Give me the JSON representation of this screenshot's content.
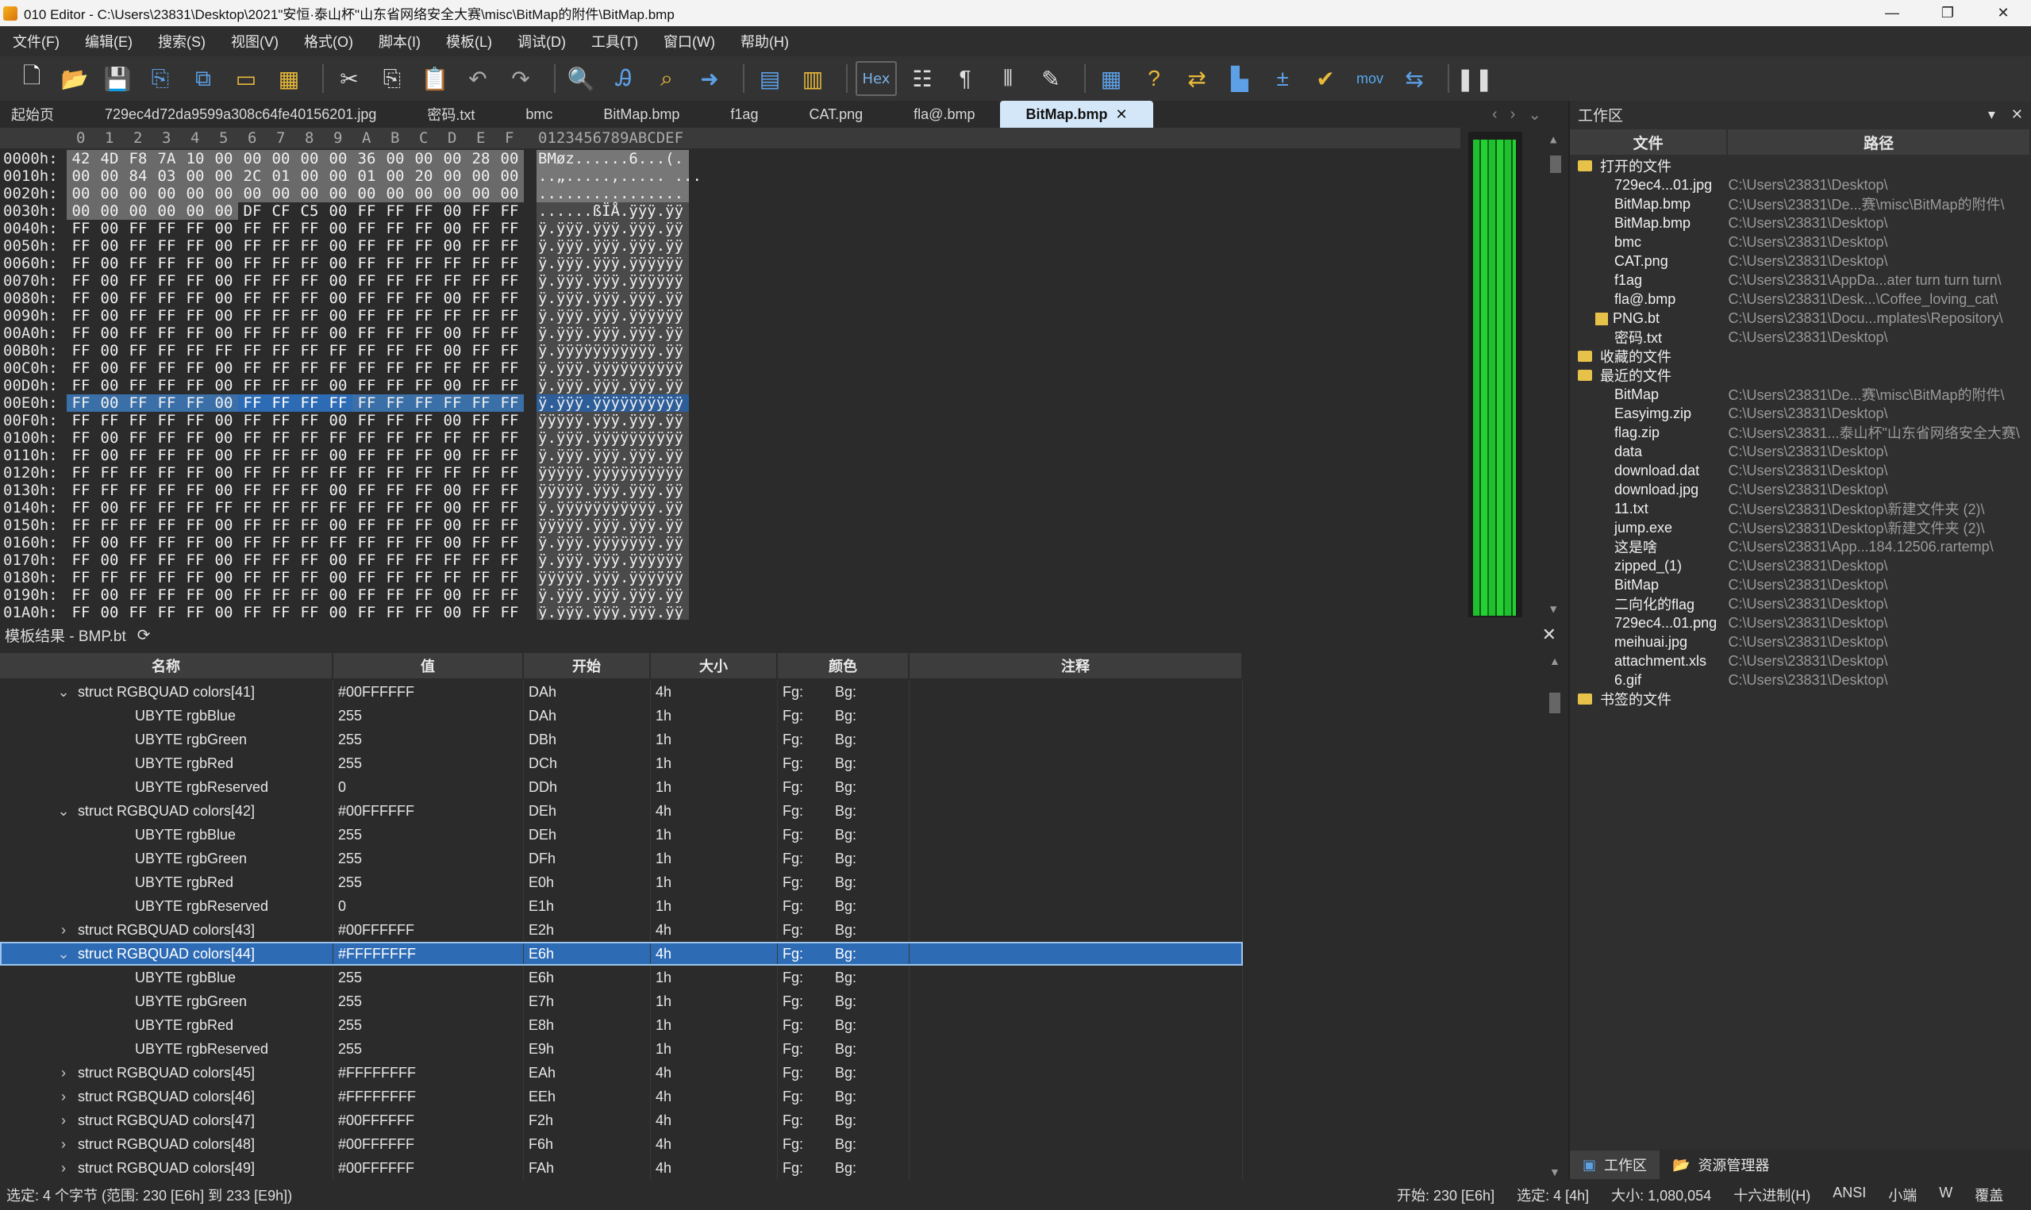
{
  "window": {
    "title": "010 Editor - C:\\Users\\23831\\Desktop\\2021\"安恒·泰山杯\"山东省网络安全大赛\\misc\\BitMap的附件\\BitMap.bmp",
    "minimize": "—",
    "maximize": "❐",
    "close": "✕"
  },
  "menu": [
    "文件(F)",
    "编辑(E)",
    "搜索(S)",
    "视图(V)",
    "格式(O)",
    "脚本(I)",
    "模板(L)",
    "调试(D)",
    "工具(T)",
    "窗口(W)",
    "帮助(H)"
  ],
  "toolbar": {
    "hex_label": "Hex",
    "mov_label": "mov"
  },
  "tabs": [
    {
      "label": "起始页"
    },
    {
      "label": "729ec4d72da9599a308c64fe40156201.jpg"
    },
    {
      "label": "密码.txt"
    },
    {
      "label": "bmc"
    },
    {
      "label": "BitMap.bmp"
    },
    {
      "label": "f1ag"
    },
    {
      "label": "CAT.png"
    },
    {
      "label": "fla@.bmp"
    },
    {
      "label": "BitMap.bmp",
      "active": true
    }
  ],
  "hex": {
    "header_cols": [
      "0",
      "1",
      "2",
      "3",
      "4",
      "5",
      "6",
      "7",
      "8",
      "9",
      "A",
      "B",
      "C",
      "D",
      "E",
      "F"
    ],
    "header_ascii": "0123456789ABCDEF",
    "rows": [
      {
        "addr": "0000h:",
        "bytes": [
          "42",
          "4D",
          "F8",
          "7A",
          "10",
          "00",
          "00",
          "00",
          "00",
          "00",
          "36",
          "00",
          "00",
          "00",
          "28",
          "00"
        ],
        "ascii": "BMøz......6...(.",
        "gray": true
      },
      {
        "addr": "0010h:",
        "bytes": [
          "00",
          "00",
          "84",
          "03",
          "00",
          "00",
          "2C",
          "01",
          "00",
          "00",
          "01",
          "00",
          "20",
          "00",
          "00",
          "00"
        ],
        "ascii": "..„.....,..... ...",
        "gray": true
      },
      {
        "addr": "0020h:",
        "bytes": [
          "00",
          "00",
          "00",
          "00",
          "00",
          "00",
          "00",
          "00",
          "00",
          "00",
          "00",
          "00",
          "00",
          "00",
          "00",
          "00"
        ],
        "ascii": "................",
        "gray": true
      },
      {
        "addr": "0030h:",
        "bytes": [
          "00",
          "00",
          "00",
          "00",
          "00",
          "00",
          "DF",
          "CF",
          "C5",
          "00",
          "FF",
          "FF",
          "FF",
          "00",
          "FF",
          "FF"
        ],
        "ascii": "......ßÏÅ.ÿÿÿ.ÿÿ",
        "gray6": true
      },
      {
        "addr": "0040h:",
        "bytes": [
          "FF",
          "00",
          "FF",
          "FF",
          "FF",
          "00",
          "FF",
          "FF",
          "FF",
          "00",
          "FF",
          "FF",
          "FF",
          "00",
          "FF",
          "FF"
        ],
        "ascii": "ÿ.ÿÿÿ.ÿÿÿ.ÿÿÿ.ÿÿ"
      },
      {
        "addr": "0050h:",
        "bytes": [
          "FF",
          "00",
          "FF",
          "FF",
          "FF",
          "00",
          "FF",
          "FF",
          "FF",
          "00",
          "FF",
          "FF",
          "FF",
          "00",
          "FF",
          "FF"
        ],
        "ascii": "ÿ.ÿÿÿ.ÿÿÿ.ÿÿÿ.ÿÿ"
      },
      {
        "addr": "0060h:",
        "bytes": [
          "FF",
          "00",
          "FF",
          "FF",
          "FF",
          "00",
          "FF",
          "FF",
          "FF",
          "00",
          "FF",
          "FF",
          "FF",
          "FF",
          "FF",
          "FF"
        ],
        "ascii": "ÿ.ÿÿÿ.ÿÿÿ.ÿÿÿÿÿÿ"
      },
      {
        "addr": "0070h:",
        "bytes": [
          "FF",
          "00",
          "FF",
          "FF",
          "FF",
          "00",
          "FF",
          "FF",
          "FF",
          "00",
          "FF",
          "FF",
          "FF",
          "FF",
          "FF",
          "FF"
        ],
        "ascii": "ÿ.ÿÿÿ.ÿÿÿ.ÿÿÿÿÿÿ"
      },
      {
        "addr": "0080h:",
        "bytes": [
          "FF",
          "00",
          "FF",
          "FF",
          "FF",
          "00",
          "FF",
          "FF",
          "FF",
          "00",
          "FF",
          "FF",
          "FF",
          "00",
          "FF",
          "FF"
        ],
        "ascii": "ÿ.ÿÿÿ.ÿÿÿ.ÿÿÿ.ÿÿ"
      },
      {
        "addr": "0090h:",
        "bytes": [
          "FF",
          "00",
          "FF",
          "FF",
          "FF",
          "00",
          "FF",
          "FF",
          "FF",
          "00",
          "FF",
          "FF",
          "FF",
          "FF",
          "FF",
          "FF"
        ],
        "ascii": "ÿ.ÿÿÿ.ÿÿÿ.ÿÿÿÿÿÿ"
      },
      {
        "addr": "00A0h:",
        "bytes": [
          "FF",
          "00",
          "FF",
          "FF",
          "FF",
          "00",
          "FF",
          "FF",
          "FF",
          "00",
          "FF",
          "FF",
          "FF",
          "00",
          "FF",
          "FF"
        ],
        "ascii": "ÿ.ÿÿÿ.ÿÿÿ.ÿÿÿ.ÿÿ"
      },
      {
        "addr": "00B0h:",
        "bytes": [
          "FF",
          "00",
          "FF",
          "FF",
          "FF",
          "FF",
          "FF",
          "FF",
          "FF",
          "FF",
          "FF",
          "FF",
          "FF",
          "00",
          "FF",
          "FF"
        ],
        "ascii": "ÿ.ÿÿÿÿÿÿÿÿÿÿÿ.ÿÿ"
      },
      {
        "addr": "00C0h:",
        "bytes": [
          "FF",
          "00",
          "FF",
          "FF",
          "FF",
          "00",
          "FF",
          "FF",
          "FF",
          "FF",
          "FF",
          "FF",
          "FF",
          "FF",
          "FF",
          "FF"
        ],
        "ascii": "ÿ.ÿÿÿ.ÿÿÿÿÿÿÿÿÿÿ"
      },
      {
        "addr": "00D0h:",
        "bytes": [
          "FF",
          "00",
          "FF",
          "FF",
          "FF",
          "00",
          "FF",
          "FF",
          "FF",
          "00",
          "FF",
          "FF",
          "FF",
          "00",
          "FF",
          "FF"
        ],
        "ascii": "ÿ.ÿÿÿ.ÿÿÿ.ÿÿÿ.ÿÿ"
      },
      {
        "addr": "00E0h:",
        "bytes": [
          "FF",
          "00",
          "FF",
          "FF",
          "FF",
          "00",
          "FF",
          "FF",
          "FF",
          "FF",
          "FF",
          "FF",
          "FF",
          "FF",
          "FF",
          "FF"
        ],
        "ascii": "ÿ.ÿÿÿ.ÿÿÿÿÿÿÿÿÿÿ",
        "selected": true
      },
      {
        "addr": "00F0h:",
        "bytes": [
          "FF",
          "FF",
          "FF",
          "FF",
          "FF",
          "00",
          "FF",
          "FF",
          "FF",
          "00",
          "FF",
          "FF",
          "FF",
          "00",
          "FF",
          "FF"
        ],
        "ascii": "ÿÿÿÿÿ.ÿÿÿ.ÿÿÿ.ÿÿ"
      },
      {
        "addr": "0100h:",
        "bytes": [
          "FF",
          "00",
          "FF",
          "FF",
          "FF",
          "00",
          "FF",
          "FF",
          "FF",
          "FF",
          "FF",
          "FF",
          "FF",
          "FF",
          "FF",
          "FF"
        ],
        "ascii": "ÿ.ÿÿÿ.ÿÿÿÿÿÿÿÿÿÿ"
      },
      {
        "addr": "0110h:",
        "bytes": [
          "FF",
          "00",
          "FF",
          "FF",
          "FF",
          "00",
          "FF",
          "FF",
          "FF",
          "00",
          "FF",
          "FF",
          "FF",
          "00",
          "FF",
          "FF"
        ],
        "ascii": "ÿ.ÿÿÿ.ÿÿÿ.ÿÿÿ.ÿÿ"
      },
      {
        "addr": "0120h:",
        "bytes": [
          "FF",
          "FF",
          "FF",
          "FF",
          "FF",
          "00",
          "FF",
          "FF",
          "FF",
          "FF",
          "FF",
          "FF",
          "FF",
          "FF",
          "FF",
          "FF"
        ],
        "ascii": "ÿÿÿÿÿ.ÿÿÿÿÿÿÿÿÿÿ"
      },
      {
        "addr": "0130h:",
        "bytes": [
          "FF",
          "FF",
          "FF",
          "FF",
          "FF",
          "00",
          "FF",
          "FF",
          "FF",
          "00",
          "FF",
          "FF",
          "FF",
          "00",
          "FF",
          "FF"
        ],
        "ascii": "ÿÿÿÿÿ.ÿÿÿ.ÿÿÿ.ÿÿ"
      },
      {
        "addr": "0140h:",
        "bytes": [
          "FF",
          "00",
          "FF",
          "FF",
          "FF",
          "FF",
          "FF",
          "FF",
          "FF",
          "FF",
          "FF",
          "FF",
          "FF",
          "00",
          "FF",
          "FF"
        ],
        "ascii": "ÿ.ÿÿÿÿÿÿÿÿÿÿÿ.ÿÿ"
      },
      {
        "addr": "0150h:",
        "bytes": [
          "FF",
          "FF",
          "FF",
          "FF",
          "FF",
          "00",
          "FF",
          "FF",
          "FF",
          "00",
          "FF",
          "FF",
          "FF",
          "00",
          "FF",
          "FF"
        ],
        "ascii": "ÿÿÿÿÿ.ÿÿÿ.ÿÿÿ.ÿÿ"
      },
      {
        "addr": "0160h:",
        "bytes": [
          "FF",
          "00",
          "FF",
          "FF",
          "FF",
          "00",
          "FF",
          "FF",
          "FF",
          "FF",
          "FF",
          "FF",
          "FF",
          "00",
          "FF",
          "FF"
        ],
        "ascii": "ÿ.ÿÿÿ.ÿÿÿÿÿÿÿ.ÿÿ"
      },
      {
        "addr": "0170h:",
        "bytes": [
          "FF",
          "00",
          "FF",
          "FF",
          "FF",
          "00",
          "FF",
          "FF",
          "FF",
          "00",
          "FF",
          "FF",
          "FF",
          "FF",
          "FF",
          "FF"
        ],
        "ascii": "ÿ.ÿÿÿ.ÿÿÿ.ÿÿÿÿÿÿ"
      },
      {
        "addr": "0180h:",
        "bytes": [
          "FF",
          "FF",
          "FF",
          "FF",
          "FF",
          "00",
          "FF",
          "FF",
          "FF",
          "00",
          "FF",
          "FF",
          "FF",
          "FF",
          "FF",
          "FF"
        ],
        "ascii": "ÿÿÿÿÿ.ÿÿÿ.ÿÿÿÿÿÿ"
      },
      {
        "addr": "0190h:",
        "bytes": [
          "FF",
          "00",
          "FF",
          "FF",
          "FF",
          "00",
          "FF",
          "FF",
          "FF",
          "00",
          "FF",
          "FF",
          "FF",
          "00",
          "FF",
          "FF"
        ],
        "ascii": "ÿ.ÿÿÿ.ÿÿÿ.ÿÿÿ.ÿÿ"
      },
      {
        "addr": "01A0h:",
        "bytes": [
          "FF",
          "00",
          "FF",
          "FF",
          "FF",
          "00",
          "FF",
          "FF",
          "FF",
          "00",
          "FF",
          "FF",
          "FF",
          "00",
          "FF",
          "FF"
        ],
        "ascii": "ÿ.ÿÿÿ.ÿÿÿ.ÿÿÿ.ÿÿ"
      }
    ]
  },
  "template": {
    "title": "模板结果 - BMP.bt",
    "refresh_icon": "⟳",
    "close_icon": "✕",
    "columns": [
      "名称",
      "值",
      "开始",
      "大小",
      "颜色",
      "注释"
    ],
    "rows": [
      {
        "name": "struct RGBQUAD colors[41]",
        "value": "#00FFFFFF",
        "start": "DAh",
        "size": "4h",
        "fg": "Fg:",
        "bg": "Bg:",
        "indent": 1,
        "chev": "down"
      },
      {
        "name": "UBYTE rgbBlue",
        "value": "255",
        "start": "DAh",
        "size": "1h",
        "fg": "Fg:",
        "bg": "Bg:",
        "indent": 2
      },
      {
        "name": "UBYTE rgbGreen",
        "value": "255",
        "start": "DBh",
        "size": "1h",
        "fg": "Fg:",
        "bg": "Bg:",
        "indent": 2
      },
      {
        "name": "UBYTE rgbRed",
        "value": "255",
        "start": "DCh",
        "size": "1h",
        "fg": "Fg:",
        "bg": "Bg:",
        "indent": 2
      },
      {
        "name": "UBYTE rgbReserved",
        "value": "0",
        "start": "DDh",
        "size": "1h",
        "fg": "Fg:",
        "bg": "Bg:",
        "indent": 2
      },
      {
        "name": "struct RGBQUAD colors[42]",
        "value": "#00FFFFFF",
        "start": "DEh",
        "size": "4h",
        "fg": "Fg:",
        "bg": "Bg:",
        "indent": 1,
        "chev": "down"
      },
      {
        "name": "UBYTE rgbBlue",
        "value": "255",
        "start": "DEh",
        "size": "1h",
        "fg": "Fg:",
        "bg": "Bg:",
        "indent": 2
      },
      {
        "name": "UBYTE rgbGreen",
        "value": "255",
        "start": "DFh",
        "size": "1h",
        "fg": "Fg:",
        "bg": "Bg:",
        "indent": 2
      },
      {
        "name": "UBYTE rgbRed",
        "value": "255",
        "start": "E0h",
        "size": "1h",
        "fg": "Fg:",
        "bg": "Bg:",
        "indent": 2
      },
      {
        "name": "UBYTE rgbReserved",
        "value": "0",
        "start": "E1h",
        "size": "1h",
        "fg": "Fg:",
        "bg": "Bg:",
        "indent": 2
      },
      {
        "name": "struct RGBQUAD colors[43]",
        "value": "#00FFFFFF",
        "start": "E2h",
        "size": "4h",
        "fg": "Fg:",
        "bg": "Bg:",
        "indent": 1,
        "chev": "right"
      },
      {
        "name": "struct RGBQUAD colors[44]",
        "value": "#FFFFFFFF",
        "start": "E6h",
        "size": "4h",
        "fg": "Fg:",
        "bg": "Bg:",
        "indent": 1,
        "chev": "down",
        "selected": true
      },
      {
        "name": "UBYTE rgbBlue",
        "value": "255",
        "start": "E6h",
        "size": "1h",
        "fg": "Fg:",
        "bg": "Bg:",
        "indent": 2
      },
      {
        "name": "UBYTE rgbGreen",
        "value": "255",
        "start": "E7h",
        "size": "1h",
        "fg": "Fg:",
        "bg": "Bg:",
        "indent": 2
      },
      {
        "name": "UBYTE rgbRed",
        "value": "255",
        "start": "E8h",
        "size": "1h",
        "fg": "Fg:",
        "bg": "Bg:",
        "indent": 2
      },
      {
        "name": "UBYTE rgbReserved",
        "value": "255",
        "start": "E9h",
        "size": "1h",
        "fg": "Fg:",
        "bg": "Bg:",
        "indent": 2
      },
      {
        "name": "struct RGBQUAD colors[45]",
        "value": "#FFFFFFFF",
        "start": "EAh",
        "size": "4h",
        "fg": "Fg:",
        "bg": "Bg:",
        "indent": 1,
        "chev": "right"
      },
      {
        "name": "struct RGBQUAD colors[46]",
        "value": "#FFFFFFFF",
        "start": "EEh",
        "size": "4h",
        "fg": "Fg:",
        "bg": "Bg:",
        "indent": 1,
        "chev": "right"
      },
      {
        "name": "struct RGBQUAD colors[47]",
        "value": "#00FFFFFF",
        "start": "F2h",
        "size": "4h",
        "fg": "Fg:",
        "bg": "Bg:",
        "indent": 1,
        "chev": "right"
      },
      {
        "name": "struct RGBQUAD colors[48]",
        "value": "#00FFFFFF",
        "start": "F6h",
        "size": "4h",
        "fg": "Fg:",
        "bg": "Bg:",
        "indent": 1,
        "chev": "right"
      },
      {
        "name": "struct RGBQUAD colors[49]",
        "value": "#00FFFFFF",
        "start": "FAh",
        "size": "4h",
        "fg": "Fg:",
        "bg": "Bg:",
        "indent": 1,
        "chev": "right"
      }
    ]
  },
  "workspace": {
    "title": "工作区",
    "col_file": "文件",
    "col_path": "路径",
    "groups": [
      {
        "label": "打开的文件",
        "items": [
          {
            "file": "729ec4...01.jpg",
            "path": "C:\\Users\\23831\\Desktop\\"
          },
          {
            "file": "BitMap.bmp",
            "path": "C:\\Users\\23831\\De...赛\\misc\\BitMap的附件\\"
          },
          {
            "file": "BitMap.bmp",
            "path": "C:\\Users\\23831\\Desktop\\"
          },
          {
            "file": "bmc",
            "path": "C:\\Users\\23831\\Desktop\\"
          },
          {
            "file": "CAT.png",
            "path": "C:\\Users\\23831\\Desktop\\"
          },
          {
            "file": "f1ag",
            "path": "C:\\Users\\23831\\AppDa...ater turn turn turn\\"
          },
          {
            "file": "fla@.bmp",
            "path": "C:\\Users\\23831\\Desk...\\Coffee_loving_cat\\"
          },
          {
            "file": "PNG.bt",
            "path": "C:\\Users\\23831\\Docu...mplates\\Repository\\",
            "bt": true
          },
          {
            "file": "密码.txt",
            "path": "C:\\Users\\23831\\Desktop\\"
          }
        ]
      },
      {
        "label": "收藏的文件",
        "items": []
      },
      {
        "label": "最近的文件",
        "items": [
          {
            "file": "BitMap",
            "path": "C:\\Users\\23831\\De...赛\\misc\\BitMap的附件\\"
          },
          {
            "file": "Easyimg.zip",
            "path": "C:\\Users\\23831\\Desktop\\"
          },
          {
            "file": "flag.zip",
            "path": "C:\\Users\\23831...泰山杯\"山东省网络安全大赛\\"
          },
          {
            "file": "data",
            "path": "C:\\Users\\23831\\Desktop\\"
          },
          {
            "file": "download.dat",
            "path": "C:\\Users\\23831\\Desktop\\"
          },
          {
            "file": "download.jpg",
            "path": "C:\\Users\\23831\\Desktop\\"
          },
          {
            "file": "11.txt",
            "path": "C:\\Users\\23831\\Desktop\\新建文件夹 (2)\\"
          },
          {
            "file": "jump.exe",
            "path": "C:\\Users\\23831\\Desktop\\新建文件夹 (2)\\"
          },
          {
            "file": "这是啥",
            "path": "C:\\Users\\23831\\App...184.12506.rartemp\\"
          },
          {
            "file": "zipped_(1)",
            "path": "C:\\Users\\23831\\Desktop\\"
          },
          {
            "file": "BitMap",
            "path": "C:\\Users\\23831\\Desktop\\"
          },
          {
            "file": "二向化的flag",
            "path": "C:\\Users\\23831\\Desktop\\"
          },
          {
            "file": "729ec4...01.png",
            "path": "C:\\Users\\23831\\Desktop\\"
          },
          {
            "file": "meihuai.jpg",
            "path": "C:\\Users\\23831\\Desktop\\"
          },
          {
            "file": "attachment.xls",
            "path": "C:\\Users\\23831\\Desktop\\"
          },
          {
            "file": "6.gif",
            "path": "C:\\Users\\23831\\Desktop\\"
          }
        ]
      },
      {
        "label": "书签的文件",
        "items": []
      }
    ],
    "bottom_tabs": [
      "工作区",
      "资源管理器"
    ]
  },
  "status": {
    "left": "选定: 4 个字节 (范围: 230 [E6h] 到 233 [E9h])",
    "start": "开始: 230 [E6h]",
    "selected": "选定: 4 [4h]",
    "size": "大小: 1,080,054",
    "mode": "十六进制(H)",
    "encoding": "ANSI",
    "endian": "小端",
    "w": "W",
    "overwrite": "覆盖"
  },
  "colors": {
    "selection": "#2d6bb5",
    "tab_active": "#d4e7f8",
    "minimap_green": "#1fbf2f"
  }
}
